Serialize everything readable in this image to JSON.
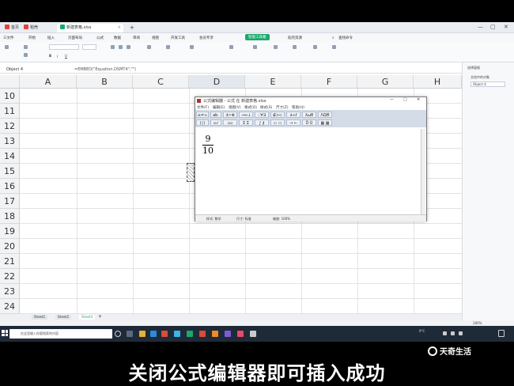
{
  "window": {
    "tabs": [
      {
        "label": "首页",
        "color": "#e0463b"
      },
      {
        "label": "稻壳",
        "color": "#e0463b"
      },
      {
        "label": "新建表格.xlsx",
        "color": "#1aa86d"
      }
    ]
  },
  "menu": {
    "items": [
      "三文件",
      "开始",
      "插入",
      "页面布局",
      "公式",
      "数据",
      "审阅",
      "视图",
      "开发工具",
      "会员专享",
      "智能工具箱",
      "稻壳资源"
    ],
    "highlight": "智能工具箱",
    "search": "查找命令"
  },
  "formula_bar": {
    "name_box": "Object 4",
    "formula": "=EMBED(\"Equation.DSMT4\",\"\")"
  },
  "columns": [
    "A",
    "B",
    "C",
    "D",
    "E",
    "F",
    "G",
    "H"
  ],
  "rows": [
    "10",
    "11",
    "12",
    "13",
    "14",
    "15",
    "16",
    "17",
    "18",
    "19",
    "20",
    "21",
    "22",
    "23",
    "24"
  ],
  "sheets": [
    "Sheet1",
    "Sheet2",
    "Sheet3"
  ],
  "active_sheet": "Sheet3",
  "side_panel": {
    "title": "选择窗格",
    "section": "文档中的对象",
    "item": "Object 4"
  },
  "dialog": {
    "title": "公式编辑器 - 公式 在 新建表格.xlsx",
    "menu": [
      "文件(F)",
      "编辑(E)",
      "视图(V)",
      "格式(O)",
      "样式(S)",
      "尺寸(Z)",
      "帮助(H)"
    ],
    "fraction": {
      "numerator": "9",
      "denominator": "10"
    },
    "status": {
      "style": "样式: 数学",
      "size": "尺寸: 标准",
      "zoom": "缩放: 100%"
    }
  },
  "taskbar": {
    "search_placeholder": "在这里输入你要搜索的内容",
    "weather": "9°C",
    "zoom": "280%"
  },
  "caption": "关闭公式编辑器即可插入成功",
  "watermark": "天奇生活"
}
